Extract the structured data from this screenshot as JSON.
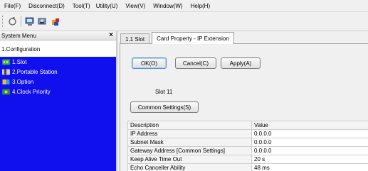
{
  "menubar": {
    "items": [
      "File(F)",
      "Disconnect(D)",
      "Tool(T)",
      "Utility(U)",
      "View(V)",
      "Window(W)",
      "Help(H)"
    ]
  },
  "toolbar": {
    "buttons": [
      "refresh-icon",
      "connect-icon",
      "user-icon",
      "plugin-icon"
    ]
  },
  "left_panel": {
    "title": "System Menu",
    "close_label": "×",
    "section": "1.Configuration",
    "items": [
      {
        "label": "1.Slot",
        "icon": "slot-icon"
      },
      {
        "label": "2.Portable Station",
        "icon": "portable-station-icon"
      },
      {
        "label": "3.Option",
        "icon": "option-icon"
      },
      {
        "label": "4.Clock Priority",
        "icon": "clock-priority-icon"
      }
    ]
  },
  "tabs": [
    {
      "label": "1.1 Slot"
    },
    {
      "label": "Card Property - IP Extension"
    }
  ],
  "buttons": {
    "ok": "OK(O)",
    "cancel": "Cancel(C)",
    "apply": "Apply(A)",
    "common_settings": "Common Settings(S)"
  },
  "slot_text": "Slot   11",
  "table": {
    "headers": [
      "Description",
      "Value"
    ],
    "rows": [
      [
        "IP Address",
        "0.0.0.0"
      ],
      [
        "Subnet Mask",
        "0.0.0.0"
      ],
      [
        "Gateway Address [Common Settings]",
        "0.0.0.0"
      ],
      [
        "Keep Alive Time Out",
        "20 s"
      ],
      [
        "Echo Canceller Ability",
        "48 ms"
      ]
    ]
  },
  "colors": {
    "tree_background": "#1010ee",
    "tree_text": "#ffffff"
  }
}
